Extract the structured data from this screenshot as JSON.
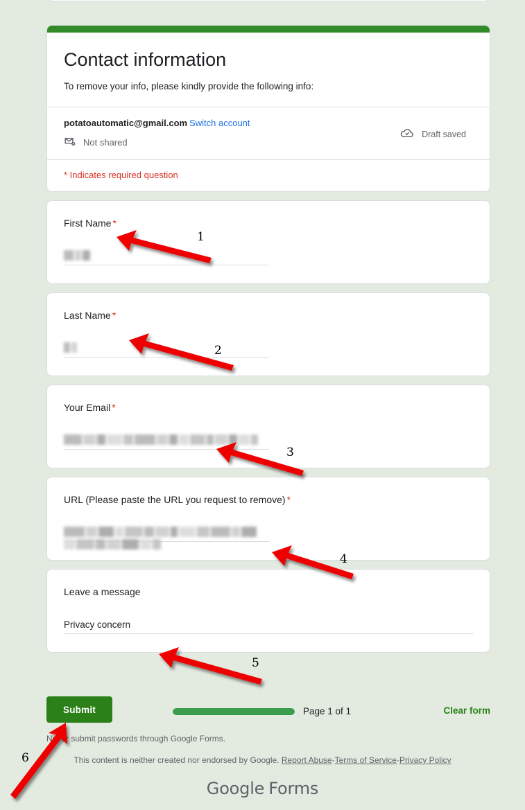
{
  "page": {
    "background_color": "#e3ebe0",
    "accent_color": "#318b29"
  },
  "header": {
    "title": "Contact information",
    "description": "To remove your info, please kindly provide the following info:",
    "account_email": "potatoautomatic@gmail.com",
    "switch_account_label": "Switch account",
    "sharing_status": "Not shared",
    "sharing_icon": "mail-off-icon",
    "draft_status": "Draft saved",
    "draft_icon": "cloud-check-icon",
    "required_note": "* Indicates required question"
  },
  "questions": [
    {
      "label": "First Name",
      "required": true,
      "star": "*",
      "value": "",
      "redacted": true,
      "width": "short"
    },
    {
      "label": "Last Name",
      "required": true,
      "star": "*",
      "value": "",
      "redacted": true,
      "width": "short"
    },
    {
      "label": "Your Email",
      "required": true,
      "star": "*",
      "value": "",
      "redacted": true,
      "width": "short"
    },
    {
      "label": "URL (Please paste the URL you request to remove)",
      "required": true,
      "star": "*",
      "value": "",
      "redacted": true,
      "width": "short"
    },
    {
      "label": "Leave a message",
      "required": false,
      "star": "",
      "value": "Privacy concern",
      "redacted": false,
      "width": "full"
    }
  ],
  "footer": {
    "submit_label": "Submit",
    "progress_percent": 100,
    "page_count_label": "Page 1 of 1",
    "clear_form_label": "Clear form",
    "password_note": "Never submit passwords through Google Forms.",
    "legal_text": "This content is neither created nor endorsed by Google.",
    "legal_links": [
      "Report Abuse",
      "Terms of Service",
      "Privacy Policy"
    ],
    "legal_separator": "-",
    "logo_google": "Google",
    "logo_forms": "Forms"
  },
  "annotations": {
    "arrow_color": "#ee0000",
    "markers": [
      {
        "number": "1"
      },
      {
        "number": "2"
      },
      {
        "number": "3"
      },
      {
        "number": "4"
      },
      {
        "number": "5"
      },
      {
        "number": "6"
      }
    ]
  }
}
